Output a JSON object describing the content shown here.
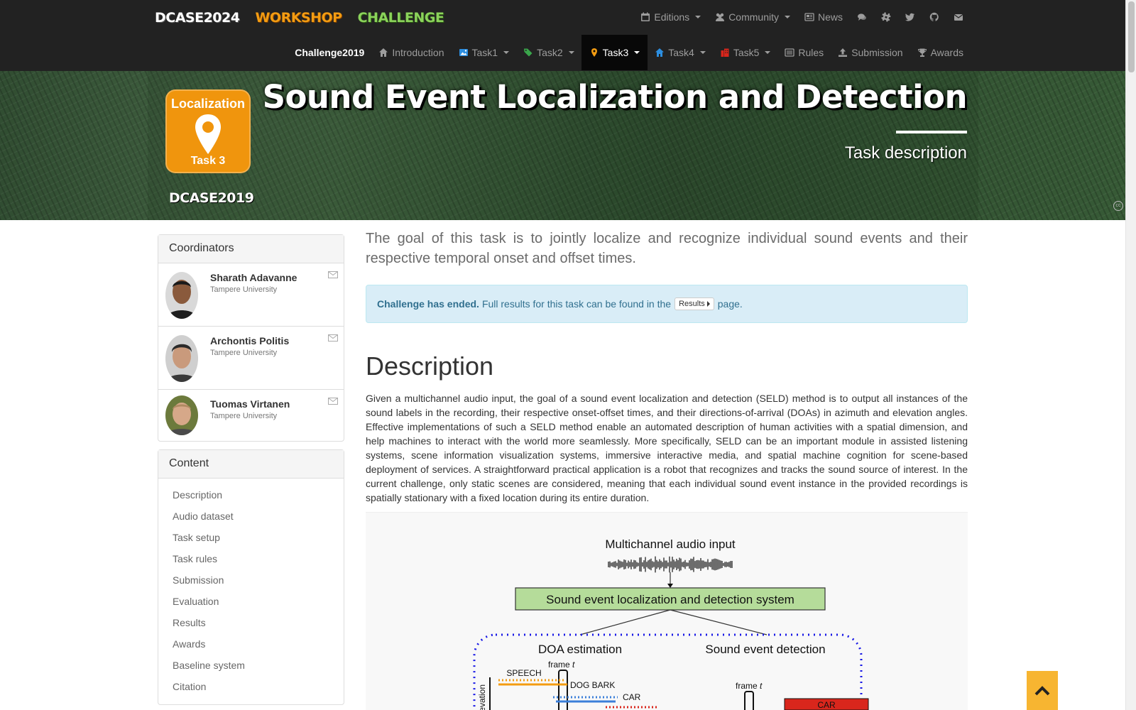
{
  "brand": {
    "dcase": "DCASE2024",
    "workshop": "WORKSHOP",
    "challenge": "CHALLENGE"
  },
  "topnav": [
    {
      "label": "Editions",
      "icon": "calendar-icon",
      "dropdown": true
    },
    {
      "label": "Community",
      "icon": "users-icon",
      "dropdown": true
    },
    {
      "label": "News",
      "icon": "newspaper-icon",
      "dropdown": false
    }
  ],
  "subnav": {
    "title": "Challenge2019",
    "items": [
      {
        "label": "Introduction",
        "icon": "home-icon",
        "dropdown": false
      },
      {
        "label": "Task1",
        "icon": "image-icon",
        "dropdown": true
      },
      {
        "label": "Task2",
        "icon": "tags-icon",
        "dropdown": true
      },
      {
        "label": "Task3",
        "icon": "map-marker-icon",
        "dropdown": true,
        "active": true
      },
      {
        "label": "Task4",
        "icon": "home-icon",
        "dropdown": true
      },
      {
        "label": "Task5",
        "icon": "building-icon",
        "dropdown": true
      },
      {
        "label": "Rules",
        "icon": "list-icon",
        "dropdown": false
      },
      {
        "label": "Submission",
        "icon": "upload-icon",
        "dropdown": false
      },
      {
        "label": "Awards",
        "icon": "trophy-icon",
        "dropdown": false
      }
    ]
  },
  "hero": {
    "badge_top": "Localization",
    "badge_bottom": "Task 3",
    "logo": "DCASE2019",
    "title": "Sound Event Localization and Detection",
    "subtitle": "Task description"
  },
  "coordinators": {
    "heading": "Coordinators",
    "people": [
      {
        "name": "Sharath Adavanne",
        "affiliation": "Tampere University"
      },
      {
        "name": "Archontis Politis",
        "affiliation": "Tampere University"
      },
      {
        "name": "Tuomas Virtanen",
        "affiliation": "Tampere University"
      }
    ]
  },
  "content": {
    "heading": "Content",
    "items": [
      "Description",
      "Audio dataset",
      "Task setup",
      "Task rules",
      "Submission",
      "Evaluation",
      "Results",
      "Awards",
      "Baseline system",
      "Citation"
    ]
  },
  "main": {
    "lead": "The goal of this task is to jointly localize and recognize individual sound events and their respective temporal onset and offset times.",
    "alert_bold": "Challenge has ended.",
    "alert_text": "Full results for this task can be found in the",
    "alert_button": "Results",
    "alert_end": "page.",
    "heading": "Description",
    "paragraph": "Given a multichannel audio input, the goal of a sound event localization and detection (SELD) method is to output all instances of the sound labels in the recording, their respective onset-offset times, and their directions-of-arrival (DOAs) in azimuth and elevation angles. Effective implementations of such a SELD method enable an automated description of human activities with a spatial dimension, and help machines to interact with the world more seamlessly. More specifically, SELD can be an important module in assisted listening systems, scene information visualization systems, immersive interactive media, and spatial machine cognition for scene-based deployment of services. A straightforward practical application is a robot that recognizes and tracks the sound source of interest. In the current challenge, only static scenes are considered, meaning that each individual sound event instance in the provided recordings is spatially stationary with a fixed location during its entire duration."
  },
  "figure": {
    "input_label": "Multichannel audio input",
    "system_label": "Sound event localization and detection system",
    "doa_label": "DOA estimation",
    "sed_label": "Sound event detection",
    "frame_label": "frame",
    "frame_var": "t",
    "speech": "SPEECH",
    "dog_bark": "DOG BARK",
    "car": "CAR",
    "elevation": "elevation",
    "colors": {
      "orange": "#f39c12",
      "blue": "#3b7fd9",
      "red": "#d9261c",
      "green_box": "#b5dc9a"
    }
  }
}
